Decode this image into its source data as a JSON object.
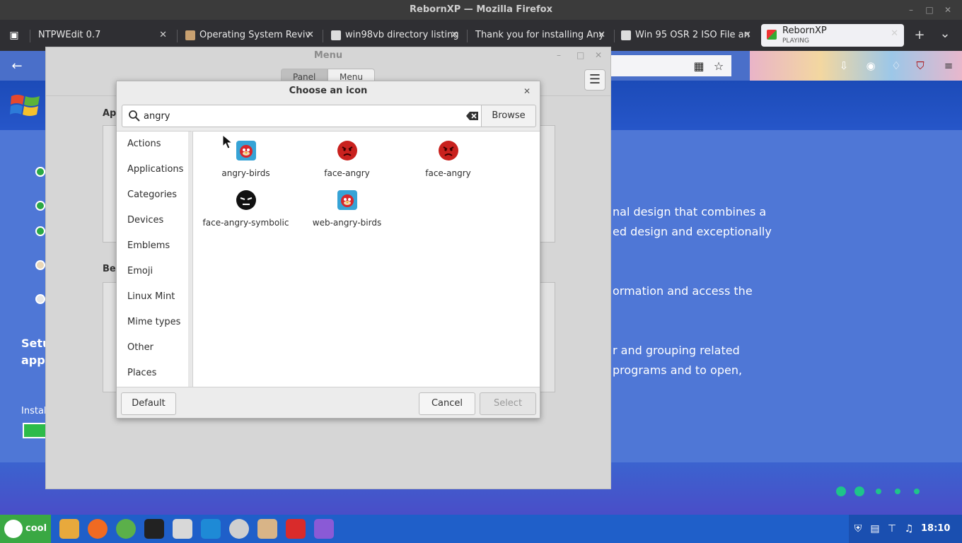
{
  "firefox": {
    "window_title": "RebornXP — Mozilla Firefox",
    "tabs": [
      {
        "label": "NTPWEdit 0.7"
      },
      {
        "label": "Operating System Reviv"
      },
      {
        "label": "win98vb directory listing"
      },
      {
        "label": "Thank you for installing Any"
      },
      {
        "label": "Win 95 OSR 2 ISO File an"
      },
      {
        "label": "RebornXP",
        "sub": "PLAYING"
      }
    ],
    "new_tab": "+",
    "list_all": "⌄"
  },
  "webpage": {
    "text_lines": [
      "nal design that combines a",
      "ed design and exceptionally",
      "ormation and access the",
      "r and grouping related",
      "programs and to open,"
    ],
    "left_fragments": [
      "Setu",
      "app",
      "Install"
    ]
  },
  "menu_window": {
    "title": "Menu",
    "tab_panel": "Panel",
    "tab_menu": "Menu",
    "section_top": "App",
    "section_bottom": "Beh"
  },
  "dialog": {
    "title": "Choose an icon",
    "search_value": "angry",
    "browse_label": "Browse",
    "categories": [
      "Actions",
      "Applications",
      "Categories",
      "Devices",
      "Emblems",
      "Emoji",
      "Linux Mint",
      "Mime types",
      "Other",
      "Places"
    ],
    "icons": [
      {
        "label": "angry-birds",
        "kind": "bird-icon"
      },
      {
        "label": "face-angry",
        "kind": "red-face-icon"
      },
      {
        "label": "face-angry",
        "kind": "red-face-icon"
      },
      {
        "label": "face-angry-symbolic",
        "kind": "black-face-icon"
      },
      {
        "label": "web-angry-birds",
        "kind": "bird-icon"
      }
    ],
    "default_label": "Default",
    "cancel_label": "Cancel",
    "select_label": "Select"
  },
  "taskbar": {
    "start_label": "cool",
    "clock": "18:10"
  },
  "colors": {
    "xp_blue": "#4f77d6",
    "taskbar": "#1f5fc9",
    "start_green": "#3aa843"
  }
}
